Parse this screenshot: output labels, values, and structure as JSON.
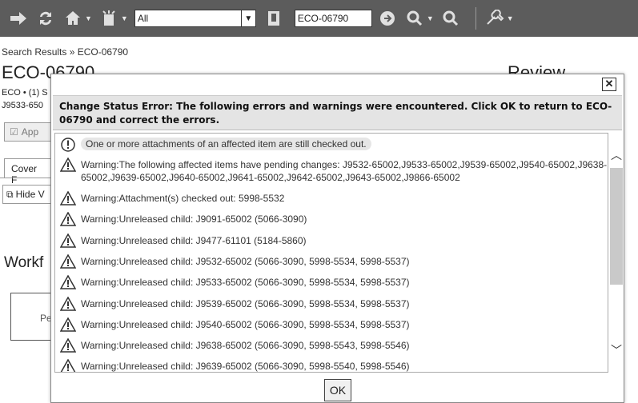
{
  "toolbar": {
    "icons": [
      "forward-arrow-icon",
      "refresh-icon",
      "home-icon",
      "new-object-icon",
      "bookmark-icon",
      "search-icon",
      "advanced-search-icon",
      "tools-icon"
    ],
    "scope_value": "All",
    "search_value": "ECO-06790"
  },
  "page": {
    "breadcrumb": "Search Results » ECO-06790",
    "title": "ECO-06790",
    "review_label": "Review",
    "meta": "ECO • (1) S",
    "items_prefix": "J9533-650",
    "approve_label": "App",
    "cover_tab": "Cover F",
    "hide_label": "Hide V",
    "workflow_title": "Workf",
    "workflow_box": "Pe"
  },
  "dialog": {
    "close_label": "✕",
    "header": "Change Status Error: The following errors and warnings were encountered. Click OK to return to ECO-06790 and correct the errors.",
    "messages": [
      {
        "type": "info",
        "text": "One or more attachments of an affected item are still checked out."
      },
      {
        "type": "warning",
        "text": "Warning:The following affected items have pending changes: J9532-65002,J9533-65002,J9539-65002,J9540-65002,J9638-65002,J9639-65002,J9640-65002,J9641-65002,J9642-65002,J9643-65002,J9866-65002"
      },
      {
        "type": "warning",
        "text": "Warning:Attachment(s) checked out: 5998-5532"
      },
      {
        "type": "warning",
        "text": "Warning:Unreleased child: J9091-65002 (5066-3090)"
      },
      {
        "type": "warning",
        "text": "Warning:Unreleased child: J9477-61101 (5184-5860)"
      },
      {
        "type": "warning",
        "text": "Warning:Unreleased child: J9532-65002 (5066-3090, 5998-5534, 5998-5537)"
      },
      {
        "type": "warning",
        "text": "Warning:Unreleased child: J9533-65002 (5066-3090, 5998-5534, 5998-5537)"
      },
      {
        "type": "warning",
        "text": "Warning:Unreleased child: J9539-65002 (5066-3090, 5998-5534, 5998-5537)"
      },
      {
        "type": "warning",
        "text": "Warning:Unreleased child: J9540-65002 (5066-3090, 5998-5534, 5998-5537)"
      },
      {
        "type": "warning",
        "text": "Warning:Unreleased child: J9638-65002 (5066-3090, 5998-5543, 5998-5546)"
      },
      {
        "type": "warning",
        "text": "Warning:Unreleased child: J9639-65002 (5066-3090, 5998-5540, 5998-5546)"
      }
    ],
    "ok_label": "OK"
  }
}
